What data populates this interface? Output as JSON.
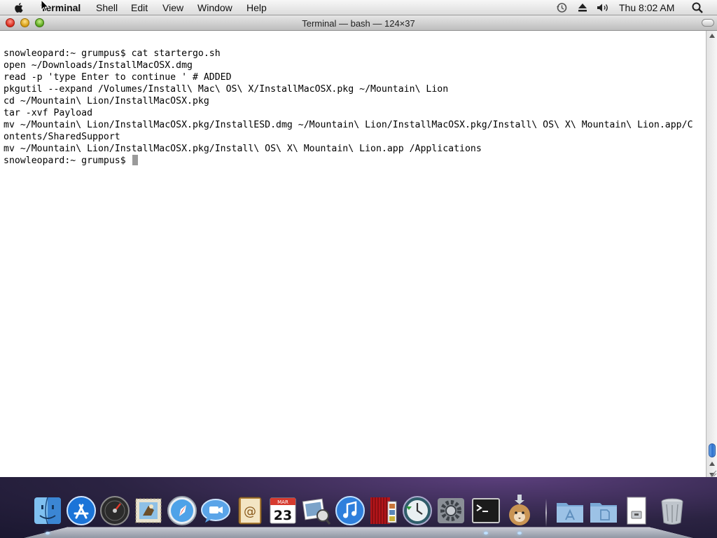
{
  "menubar": {
    "app_name": "Terminal",
    "items": [
      "Shell",
      "Edit",
      "View",
      "Window",
      "Help"
    ],
    "clock": "Thu 8:02 AM",
    "status_icons": [
      "time-machine-icon",
      "eject-icon",
      "volume-icon",
      "spotlight-icon"
    ]
  },
  "window": {
    "title": "Terminal — bash — 124×37",
    "lines": [
      "snowleopard:~ grumpus$ cat startergo.sh",
      "open ~/Downloads/InstallMacOSX.dmg",
      "read -p 'type Enter to continue ' # ADDED",
      "pkgutil --expand /Volumes/Install\\ Mac\\ OS\\ X/InstallMacOSX.pkg ~/Mountain\\ Lion",
      "cd ~/Mountain\\ Lion/InstallMacOSX.pkg",
      "tar -xvf Payload",
      "mv ~/Mountain\\ Lion/InstallMacOSX.pkg/InstallESD.dmg ~/Mountain\\ Lion/InstallMacOSX.pkg/Install\\ OS\\ X\\ Mountain\\ Lion.app/C",
      "ontents/SharedSupport",
      "mv ~/Mountain\\ Lion/InstallMacOSX.pkg/Install\\ OS\\ X\\ Mountain\\ Lion.app /Applications"
    ],
    "prompt": "snowleopard:~ grumpus$ "
  },
  "dock": {
    "calendar_month": "MAR",
    "calendar_day": "23",
    "apps": [
      "finder-icon",
      "app-store-icon",
      "dashboard-icon",
      "mail-icon",
      "safari-icon",
      "ichat-icon",
      "address-book-icon",
      "ical-icon",
      "preview-icon",
      "itunes-icon",
      "photo-booth-icon",
      "time-machine-icon",
      "system-preferences-icon",
      "terminal-icon",
      "mountain-lion-installer-icon",
      "applications-folder-icon",
      "documents-folder-icon",
      "downloads-stack-icon",
      "trash-icon"
    ]
  }
}
